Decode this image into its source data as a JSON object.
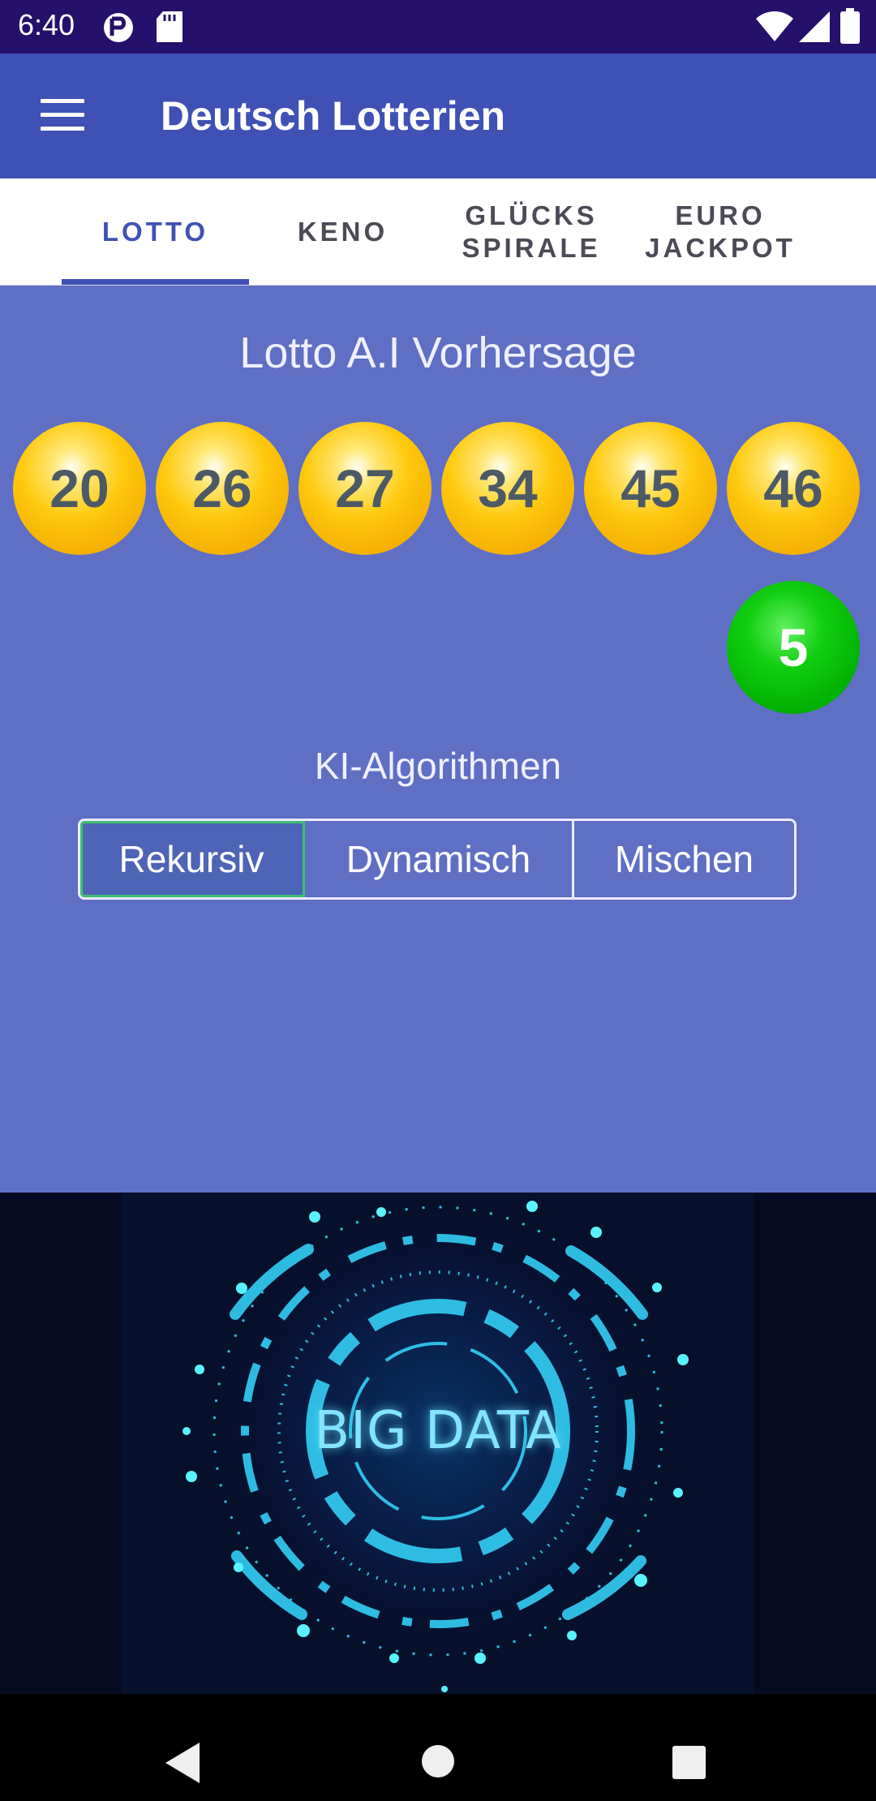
{
  "status_bar": {
    "time": "6:40",
    "icons": [
      "vpn-key-icon",
      "sd-card-icon",
      "wifi-icon",
      "signal-icon",
      "battery-icon"
    ]
  },
  "app_bar": {
    "title": "Deutsch Lotterien",
    "menu_icon": "hamburger-menu-icon"
  },
  "tabs": [
    {
      "label": "LOTTO",
      "active": true
    },
    {
      "label": "KENO",
      "active": false
    },
    {
      "label": "GLÜCKS\nSPIRALE",
      "active": false
    },
    {
      "label": "EURO\nJACKPOT",
      "active": false
    }
  ],
  "prediction": {
    "title": "Lotto A.I Vorhersage",
    "numbers": [
      "20",
      "26",
      "27",
      "34",
      "45",
      "46"
    ],
    "bonus_number": "5"
  },
  "algorithms": {
    "title": "KI-Algorithmen",
    "options": [
      {
        "label": "Rekursiv",
        "selected": true
      },
      {
        "label": "Dynamisch",
        "selected": false
      },
      {
        "label": "Mischen",
        "selected": false
      }
    ]
  },
  "banner": {
    "text": "BIG DATA"
  },
  "nav_bar": {
    "icons": [
      "back-icon",
      "home-icon",
      "recent-apps-icon"
    ]
  },
  "colors": {
    "status_bar": "#25106b",
    "primary": "#3f51b5",
    "content_background": "#5f6fc4",
    "number_ball": "#ffc90d",
    "bonus_ball": "#11ce11",
    "banner_background": "#050a21",
    "banner_glow": "#82e4ff"
  }
}
